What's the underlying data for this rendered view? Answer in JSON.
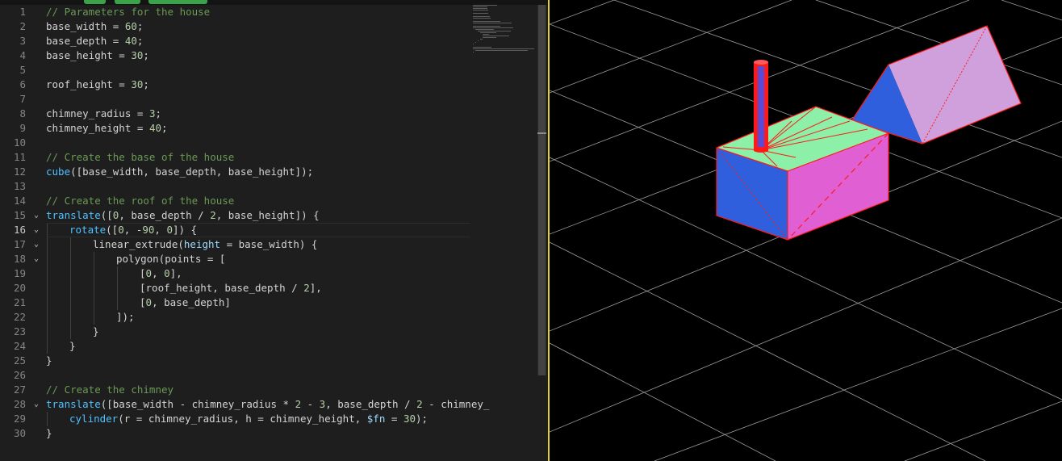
{
  "editor": {
    "lines": [
      {
        "n": "1",
        "indent": 0,
        "fold": false,
        "tokens": [
          {
            "t": "// Parameters for the house",
            "c": "com"
          }
        ]
      },
      {
        "n": "2",
        "indent": 0,
        "fold": false,
        "tokens": [
          {
            "t": "base_width = "
          },
          {
            "t": "60",
            "c": "num"
          },
          {
            "t": ";"
          }
        ]
      },
      {
        "n": "3",
        "indent": 0,
        "fold": false,
        "tokens": [
          {
            "t": "base_depth = "
          },
          {
            "t": "40",
            "c": "num"
          },
          {
            "t": ";"
          }
        ]
      },
      {
        "n": "4",
        "indent": 0,
        "fold": false,
        "tokens": [
          {
            "t": "base_height = "
          },
          {
            "t": "30",
            "c": "num"
          },
          {
            "t": ";"
          }
        ]
      },
      {
        "n": "5",
        "indent": 0,
        "fold": false,
        "tokens": []
      },
      {
        "n": "6",
        "indent": 0,
        "fold": false,
        "tokens": [
          {
            "t": "roof_height = "
          },
          {
            "t": "30",
            "c": "num"
          },
          {
            "t": ";"
          }
        ]
      },
      {
        "n": "7",
        "indent": 0,
        "fold": false,
        "tokens": []
      },
      {
        "n": "8",
        "indent": 0,
        "fold": false,
        "tokens": [
          {
            "t": "chimney_radius = "
          },
          {
            "t": "3",
            "c": "num"
          },
          {
            "t": ";"
          }
        ]
      },
      {
        "n": "9",
        "indent": 0,
        "fold": false,
        "tokens": [
          {
            "t": "chimney_height = "
          },
          {
            "t": "40",
            "c": "num"
          },
          {
            "t": ";"
          }
        ]
      },
      {
        "n": "10",
        "indent": 0,
        "fold": false,
        "tokens": []
      },
      {
        "n": "11",
        "indent": 0,
        "fold": false,
        "tokens": [
          {
            "t": "// Create the base of the house",
            "c": "com"
          }
        ]
      },
      {
        "n": "12",
        "indent": 0,
        "fold": false,
        "tokens": [
          {
            "t": "cube",
            "c": "fn"
          },
          {
            "t": "([base_width, base_depth, base_height]);"
          }
        ]
      },
      {
        "n": "13",
        "indent": 0,
        "fold": false,
        "tokens": []
      },
      {
        "n": "14",
        "indent": 0,
        "fold": false,
        "tokens": [
          {
            "t": "// Create the roof of the house",
            "c": "com"
          }
        ]
      },
      {
        "n": "15",
        "indent": 0,
        "fold": true,
        "tokens": [
          {
            "t": "translate",
            "c": "fn"
          },
          {
            "t": "(["
          },
          {
            "t": "0",
            "c": "num"
          },
          {
            "t": ", base_depth / "
          },
          {
            "t": "2",
            "c": "num"
          },
          {
            "t": ", base_height]) {"
          }
        ]
      },
      {
        "n": "16",
        "indent": 1,
        "fold": true,
        "current": true,
        "tokens": [
          {
            "t": "rotate",
            "c": "fn"
          },
          {
            "t": "(["
          },
          {
            "t": "0",
            "c": "num"
          },
          {
            "t": ", -"
          },
          {
            "t": "90",
            "c": "num"
          },
          {
            "t": ", "
          },
          {
            "t": "0",
            "c": "num"
          },
          {
            "t": "]) {"
          }
        ]
      },
      {
        "n": "17",
        "indent": 2,
        "fold": true,
        "tokens": [
          {
            "t": "linear_extrude("
          },
          {
            "t": "height",
            "c": "var"
          },
          {
            "t": " = base_width) {"
          }
        ]
      },
      {
        "n": "18",
        "indent": 3,
        "fold": true,
        "tokens": [
          {
            "t": "polygon(points = ["
          }
        ]
      },
      {
        "n": "19",
        "indent": 4,
        "fold": false,
        "tokens": [
          {
            "t": "["
          },
          {
            "t": "0",
            "c": "num"
          },
          {
            "t": ", "
          },
          {
            "t": "0",
            "c": "num"
          },
          {
            "t": "],"
          }
        ]
      },
      {
        "n": "20",
        "indent": 4,
        "fold": false,
        "tokens": [
          {
            "t": "[roof_height, base_depth / "
          },
          {
            "t": "2",
            "c": "num"
          },
          {
            "t": "],"
          }
        ]
      },
      {
        "n": "21",
        "indent": 4,
        "fold": false,
        "tokens": [
          {
            "t": "["
          },
          {
            "t": "0",
            "c": "num"
          },
          {
            "t": ", base_depth]"
          }
        ]
      },
      {
        "n": "22",
        "indent": 3,
        "fold": false,
        "tokens": [
          {
            "t": "]);"
          }
        ]
      },
      {
        "n": "23",
        "indent": 2,
        "fold": false,
        "tokens": [
          {
            "t": "}"
          }
        ]
      },
      {
        "n": "24",
        "indent": 1,
        "fold": false,
        "tokens": [
          {
            "t": "}"
          }
        ]
      },
      {
        "n": "25",
        "indent": 0,
        "fold": false,
        "tokens": [
          {
            "t": "}"
          }
        ]
      },
      {
        "n": "26",
        "indent": 0,
        "fold": false,
        "tokens": []
      },
      {
        "n": "27",
        "indent": 0,
        "fold": false,
        "tokens": [
          {
            "t": "// Create the chimney",
            "c": "com"
          }
        ]
      },
      {
        "n": "28",
        "indent": 0,
        "fold": true,
        "tokens": [
          {
            "t": "translate",
            "c": "fn"
          },
          {
            "t": "([base_width - chimney_radius * "
          },
          {
            "t": "2",
            "c": "num"
          },
          {
            "t": " - "
          },
          {
            "t": "3",
            "c": "num"
          },
          {
            "t": ", base_depth / "
          },
          {
            "t": "2",
            "c": "num"
          },
          {
            "t": " - chimney_"
          }
        ]
      },
      {
        "n": "29",
        "indent": 1,
        "fold": false,
        "tokens": [
          {
            "t": "cylinder",
            "c": "fn"
          },
          {
            "t": "(r = chimney_radius, h = chimney_height, "
          },
          {
            "t": "$fn",
            "c": "var"
          },
          {
            "t": " = "
          },
          {
            "t": "30",
            "c": "num"
          },
          {
            "t": ");"
          }
        ]
      },
      {
        "n": "30",
        "indent": 0,
        "fold": false,
        "tokens": [
          {
            "t": "}"
          }
        ]
      }
    ],
    "fold_glyph": "⌄"
  },
  "colors": {
    "comment": "#6a9955",
    "number": "#b5cea8",
    "function": "#4fc1ff",
    "variable": "#9cdcfe",
    "text": "#d4d4d4",
    "line_number": "#858585",
    "editor_bg": "#1e1e1e",
    "splitter": "#e0d22a",
    "viewport_bg": "#000000",
    "face_green": "#8cf0a8",
    "face_blue": "#2f5fdc",
    "face_magenta": "#e05fd2",
    "face_lilac": "#cfa0dc",
    "edge_red": "#ff1a1a"
  }
}
